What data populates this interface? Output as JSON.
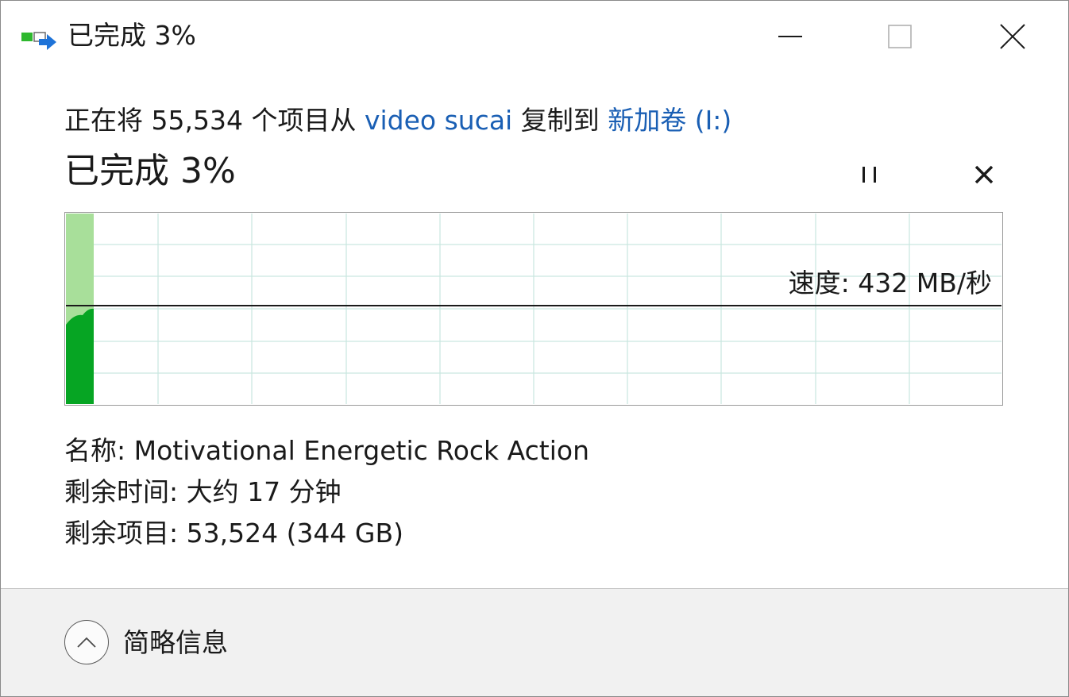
{
  "window": {
    "title": "已完成 3%",
    "icon": "file-copy-icon"
  },
  "status": {
    "prefix": "正在将 55,534 个项目从 ",
    "source": "video sucai",
    "middle": " 复制到 ",
    "destination": "新加卷 (I:)"
  },
  "progress": {
    "title": "已完成 3%",
    "percent": 3,
    "speed_label": "速度: 432 MB/秒"
  },
  "details": {
    "name": "名称: Motivational Energetic Rock Action",
    "time_remaining": "剩余时间: 大约 17 分钟",
    "items_remaining": "剩余项目: 53,524 (344 GB)"
  },
  "footer": {
    "toggle_label": "简略信息",
    "toggle_icon": "chevron-up-icon"
  },
  "colors": {
    "link": "#1a5fb4",
    "graph_fill": "#06a523",
    "graph_light": "#a8df9a",
    "grid": "#c9e6e0"
  }
}
